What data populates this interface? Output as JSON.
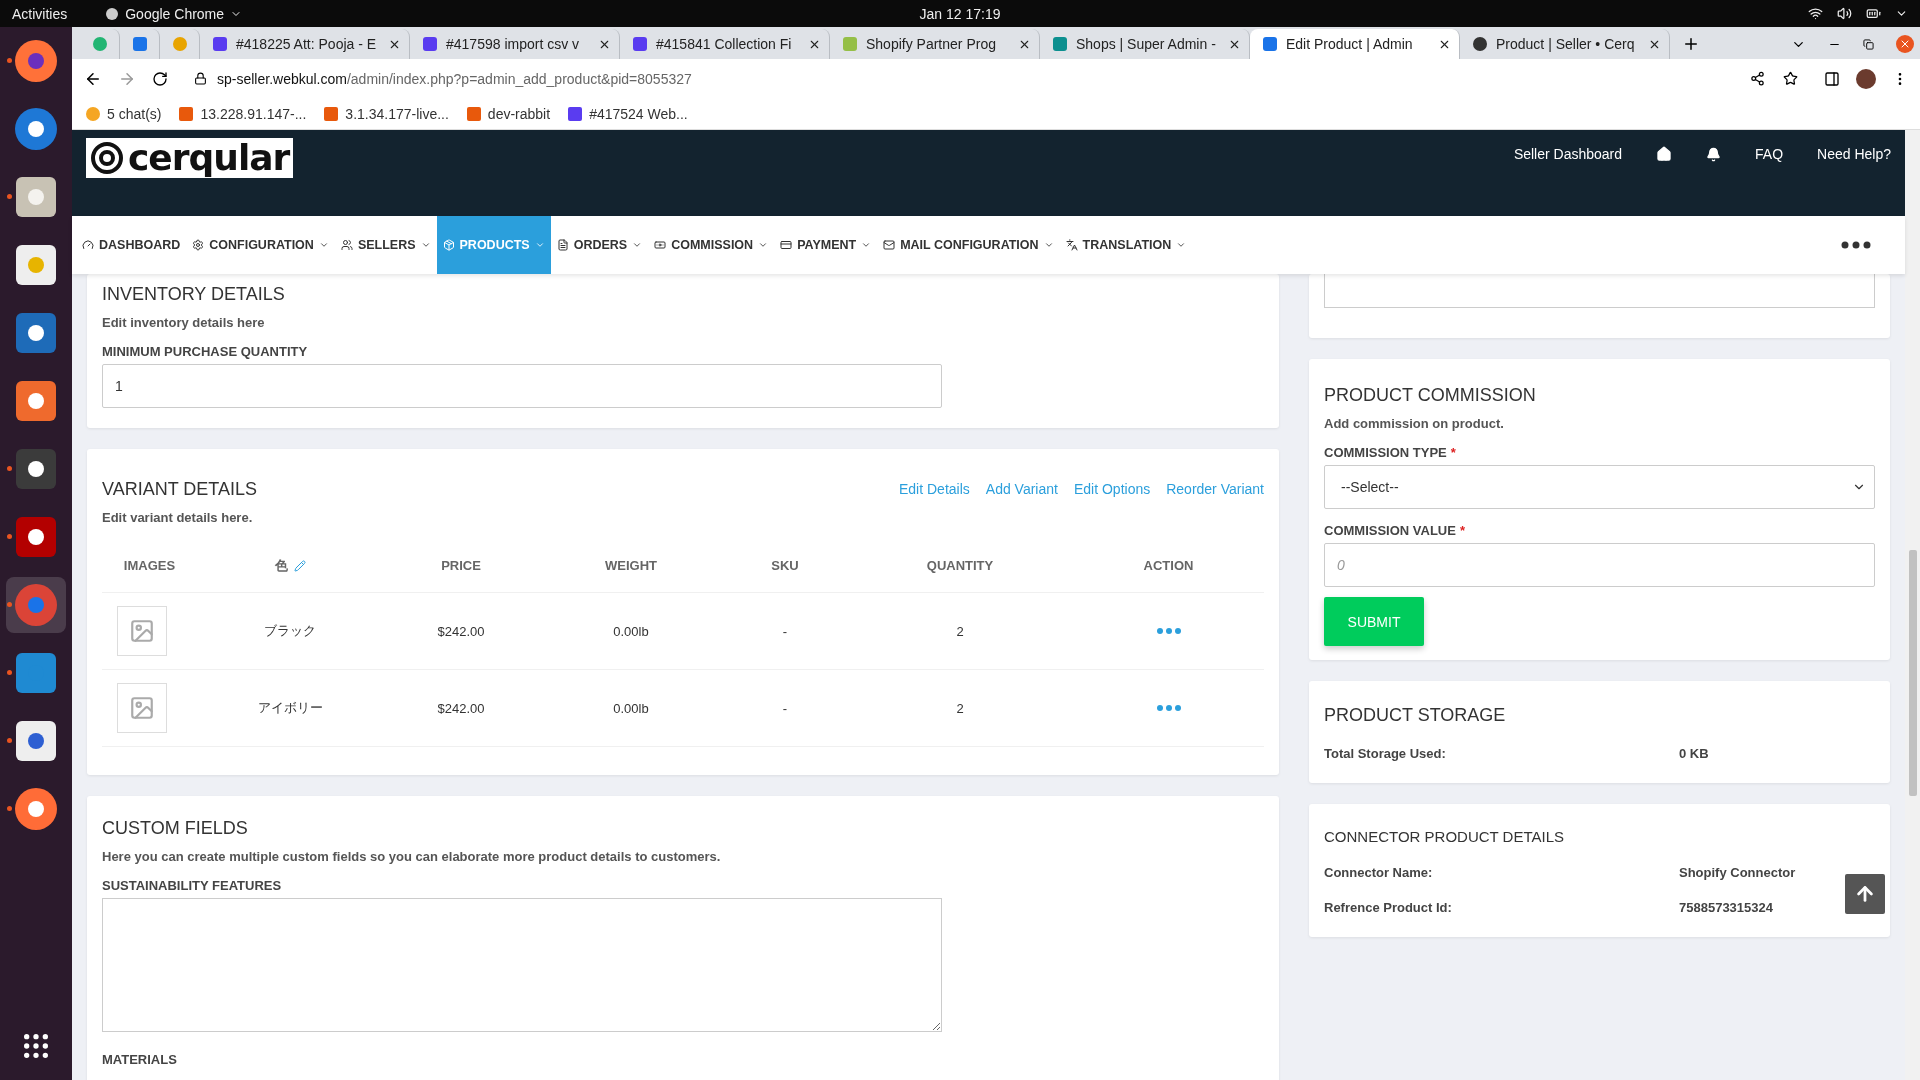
{
  "os_bar": {
    "activities": "Activities",
    "app": "Google Chrome",
    "date": "Jan 12",
    "time": "17:19"
  },
  "dock": [
    {
      "kind": "firefox",
      "running": true,
      "selected": false
    },
    {
      "kind": "mail",
      "running": false,
      "selected": false
    },
    {
      "kind": "files",
      "running": true,
      "selected": false
    },
    {
      "kind": "music",
      "running": false,
      "selected": false
    },
    {
      "kind": "writer",
      "running": false,
      "selected": false
    },
    {
      "kind": "store",
      "running": false,
      "selected": false
    },
    {
      "kind": "terminal",
      "running": true,
      "selected": false
    },
    {
      "kind": "ftp",
      "running": true,
      "selected": false
    },
    {
      "kind": "chrome",
      "running": true,
      "selected": true
    },
    {
      "kind": "code",
      "running": true,
      "selected": false
    },
    {
      "kind": "editor",
      "running": true,
      "selected": false
    },
    {
      "kind": "postman",
      "running": true,
      "selected": false
    }
  ],
  "tabs": [
    {
      "selected": false
    },
    {
      "selected": false
    },
    {
      "selected": false
    },
    {
      "title": "#418225 Att: Pooja - E",
      "selected": false
    },
    {
      "title": "#417598 import csv v",
      "selected": false
    },
    {
      "title": "#415841 Collection Fi",
      "selected": false
    },
    {
      "title": "Shopify Partner Prog",
      "selected": false
    },
    {
      "title": "Shops | Super Admin -",
      "selected": false
    },
    {
      "title": "Edit Product | Admin",
      "selected": true
    },
    {
      "title": "Product | Seller • Cerq",
      "selected": false
    }
  ],
  "address": {
    "host": "sp-seller.webkul.com",
    "path": "/admin/index.php?p=admin_add_product&pid=8055327"
  },
  "bookmarks": [
    "5 chat(s)",
    "13.228.91.147-...",
    "3.1.34.177-live...",
    "dev-rabbit",
    "#417524 Web..."
  ],
  "header": {
    "logo": "cerqular",
    "links": [
      {
        "kind": "text",
        "label": "Seller Dashboard"
      },
      {
        "kind": "home"
      },
      {
        "kind": "bell"
      },
      {
        "kind": "text",
        "label": "FAQ"
      },
      {
        "kind": "text",
        "label": "Need Help?"
      }
    ]
  },
  "nav": [
    {
      "label": "DASHBOARD",
      "has_menu": false,
      "selected": false
    },
    {
      "label": "CONFIGURATION",
      "has_menu": true,
      "selected": false
    },
    {
      "label": "SELLERS",
      "has_menu": true,
      "selected": false
    },
    {
      "label": "PRODUCTS",
      "has_menu": true,
      "selected": true
    },
    {
      "label": "ORDERS",
      "has_menu": true,
      "selected": false
    },
    {
      "label": "COMMISSION",
      "has_menu": true,
      "selected": false
    },
    {
      "label": "PAYMENT",
      "has_menu": true,
      "selected": false
    },
    {
      "label": "MAIL CONFIGURATION",
      "has_menu": true,
      "selected": false
    },
    {
      "label": "TRANSLATION",
      "has_menu": true,
      "selected": false
    }
  ],
  "inventory": {
    "title": "INVENTORY DETAILS",
    "subtitle": "Edit inventory details here",
    "field_label": "MINIMUM PURCHASE QUANTITY",
    "value": "1"
  },
  "variants": {
    "title": "VARIANT DETAILS",
    "subtitle": "Edit variant details here.",
    "links": [
      "Edit Details",
      "Add Variant",
      "Edit Options",
      "Reorder Variant"
    ],
    "columns": [
      {
        "label": "IMAGES",
        "editable": false
      },
      {
        "label": "色",
        "editable": true
      },
      {
        "label": "PRICE",
        "editable": false
      },
      {
        "label": "WEIGHT",
        "editable": false
      },
      {
        "label": "SKU",
        "editable": false
      },
      {
        "label": "QUANTITY",
        "editable": false
      },
      {
        "label": "ACTION",
        "editable": false
      }
    ],
    "rows": [
      {
        "option": "ブラック",
        "price": "$242.00",
        "weight": "0.00lb",
        "sku": "-",
        "quantity": "2"
      },
      {
        "option": "アイボリー",
        "price": "$242.00",
        "weight": "0.00lb",
        "sku": "-",
        "quantity": "2"
      }
    ]
  },
  "custom_fields": {
    "title": "CUSTOM FIELDS",
    "subtitle": "Here you can create multiple custom fields so you can elaborate more product details to customers.",
    "fields": [
      "SUSTAINABILITY FEATURES"
    ],
    "next_label": "MATERIALS"
  },
  "commission": {
    "title": "PRODUCT COMMISSION",
    "subtitle": "Add commission on product.",
    "type_label": "COMMISSION TYPE",
    "type_mark": "*",
    "type_value": "--Select--",
    "value_label": "COMMISSION VALUE",
    "value_mark": "*",
    "value_placeholder": "0",
    "submit": "SUBMIT"
  },
  "storage": {
    "title": "PRODUCT STORAGE",
    "rows": [
      {
        "label": "Total Storage Used:",
        "value": "0 KB"
      }
    ]
  },
  "connector": {
    "title": "CONNECTOR PRODUCT DETAILS",
    "rows": [
      {
        "label": "Connector Name:",
        "value": "Shopify Connector"
      },
      {
        "label": "Refrence Product Id:",
        "value": "7588573315324"
      }
    ]
  }
}
